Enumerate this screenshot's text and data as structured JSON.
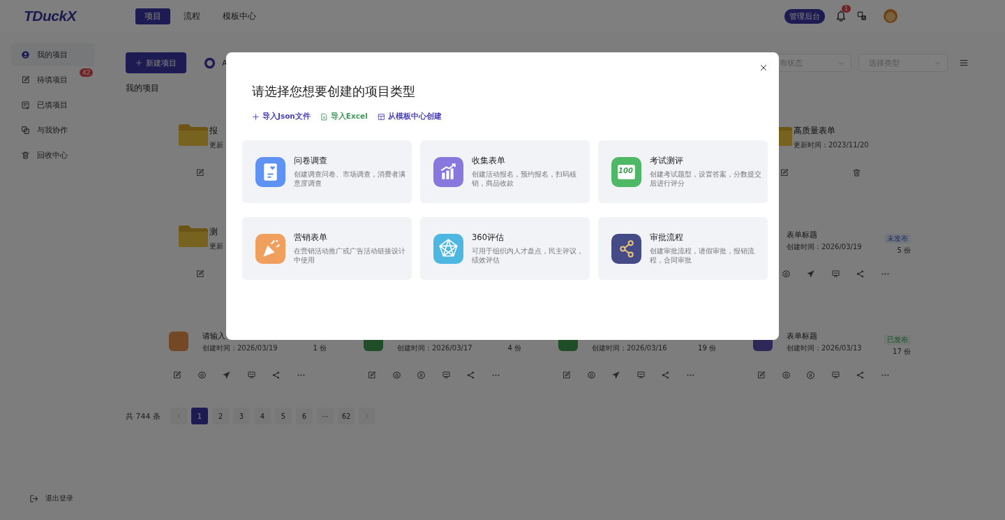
{
  "header": {
    "logo": "TDuckX",
    "nav": [
      {
        "label": "项目",
        "selected": true
      },
      {
        "label": "流程",
        "selected": false
      },
      {
        "label": "模板中心",
        "selected": false
      }
    ],
    "admin_button": "管理后台",
    "notification_count": "1"
  },
  "sidebar": {
    "items": [
      {
        "label": "我的项目",
        "selected": true
      },
      {
        "label": "待填项目",
        "badge": "42",
        "selected": false
      },
      {
        "label": "已填项目",
        "selected": false
      },
      {
        "label": "与我协作",
        "selected": false
      },
      {
        "label": "回收中心",
        "selected": false
      }
    ],
    "logout": "退出登录"
  },
  "toolbar": {
    "new_button": "新建项目",
    "ai_label": "A",
    "section_title": "我的项目",
    "filters": [
      {
        "placeholder": "布状态"
      },
      {
        "placeholder": "选择类型"
      }
    ]
  },
  "projects": [
    [
      {
        "kind": "folder",
        "title": "报",
        "subtitle": "更新",
        "trash_shown": false
      },
      {
        "kind": "covered"
      },
      {
        "kind": "covered"
      },
      {
        "kind": "folder",
        "title": "高质量表单",
        "subtitle": "更新时间：2023/11/20",
        "trash_shown": true
      }
    ],
    [
      {
        "kind": "folder",
        "title": "测",
        "subtitle": "更新",
        "trash_shown": false
      },
      {
        "kind": "covered"
      },
      {
        "kind": "covered"
      },
      {
        "kind": "form",
        "title": "表单标题",
        "status": "未发布",
        "published": false,
        "edit_shown": false,
        "date": "创建时间：2026/03/19",
        "count": "5 份"
      }
    ],
    [
      {
        "kind": "form",
        "color": "#744825",
        "title": "请输入",
        "published": false,
        "date": "创建时间：2026/03/19",
        "count": "1 份"
      },
      {
        "kind": "form",
        "color": "#1f4d27",
        "published": true,
        "date": "创建时间：2026/03/17",
        "count": "4 份"
      },
      {
        "kind": "form",
        "color": "#1f4d27",
        "published": false,
        "date": "创建时间：2026/03/16",
        "count": "19 份"
      },
      {
        "kind": "form",
        "color": "#2e2858",
        "title": "表单标题",
        "status": "已发布",
        "published": true,
        "date": "创建时间：2026/03/13",
        "count": "17 份"
      }
    ]
  ],
  "pagination": {
    "total": "共 744 条",
    "pages": [
      {
        "label": "1",
        "selected": true
      },
      {
        "label": "2",
        "selected": false
      },
      {
        "label": "3",
        "selected": false
      },
      {
        "label": "4",
        "selected": false
      },
      {
        "label": "5",
        "selected": false
      },
      {
        "label": "6",
        "selected": false
      },
      {
        "label": "···",
        "selected": false
      },
      {
        "label": "62",
        "selected": false
      }
    ]
  },
  "dialog": {
    "title": "请选择您想要创建的项目类型",
    "links": [
      {
        "label": "导入Json文件",
        "color": "#4b43b5"
      },
      {
        "label": "导入Excel",
        "color": "#3f9a5a"
      },
      {
        "label": "从模板中心创建",
        "color": "#4b43b5"
      }
    ],
    "types": [
      {
        "title": "问卷调查",
        "description": "创建调查问卷、市场调查，消费者满意度调查",
        "color": "#5e93f5"
      },
      {
        "title": "收集表单",
        "description": "创建活动报名，预约报名，扫码核销，商品收款",
        "color": "#8877dd"
      },
      {
        "title": "考试测评",
        "description": "创建考试题型，设置答案，分数提交后进行评分",
        "color": "#4fb866",
        "icon_text": "100"
      },
      {
        "title": "营销表单",
        "description": "在营销活动推广或广告活动链接设计中使用",
        "color": "#f0a05c"
      },
      {
        "title": "360评估",
        "description": "可用于组织内人才盘点，民主评议，绩效评估",
        "color": "#4cb8e2"
      },
      {
        "title": "审批流程",
        "description": "创建审批流程，请假审批，报销流程，合同审批",
        "color": "#454b86"
      }
    ]
  }
}
